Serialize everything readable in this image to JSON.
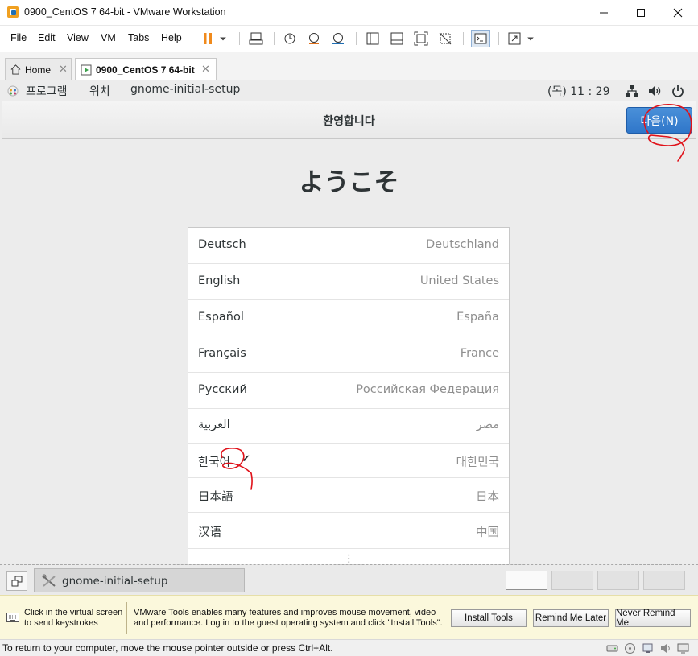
{
  "window": {
    "title": "0900_CentOS 7 64-bit - VMware Workstation",
    "controls": [
      "minimize",
      "maximize",
      "close"
    ]
  },
  "menubar": {
    "items": [
      "File",
      "Edit",
      "View",
      "VM",
      "Tabs",
      "Help"
    ]
  },
  "tabs": [
    {
      "label": "Home",
      "active": false
    },
    {
      "label": "0900_CentOS 7 64-bit",
      "active": true
    }
  ],
  "gnome_topbar": {
    "applications": "프로그램",
    "places": "위치",
    "app_name": "gnome-initial-setup",
    "clock": "(목) 11 : 29",
    "icons": [
      "network-icon",
      "volume-icon",
      "power-icon"
    ]
  },
  "setup": {
    "header_title": "환영합니다",
    "next_button": "다음(N)",
    "welcome": "ようこそ",
    "languages": [
      {
        "name": "Deutsch",
        "region": "Deutschland",
        "selected": false
      },
      {
        "name": "English",
        "region": "United States",
        "selected": false
      },
      {
        "name": "Español",
        "region": "España",
        "selected": false
      },
      {
        "name": "Français",
        "region": "France",
        "selected": false
      },
      {
        "name": "Русский",
        "region": "Российская Федерация",
        "selected": false
      },
      {
        "name": "العربية",
        "region": "مصر",
        "selected": false
      },
      {
        "name": "한국어",
        "region": "대한민국",
        "selected": true,
        "check": "✔"
      },
      {
        "name": "日本語",
        "region": "日本",
        "selected": false
      },
      {
        "name": "汉语",
        "region": "中国",
        "selected": false
      }
    ],
    "more_indicator": "⋮"
  },
  "taskbar": {
    "task_label": "gnome-initial-setup",
    "workspaces": 4,
    "active_workspace": 1
  },
  "tools_bar": {
    "hint": "Click in the virtual screen\nto send keystrokes",
    "message": "VMware Tools enables many features and improves mouse movement, video and performance. Log in to the guest operating system and click \"Install Tools\".",
    "install_button": "Install Tools",
    "remind_button": "Remind Me Later",
    "never_button": "Never Remind Me"
  },
  "statusbar": {
    "message": "To return to your computer, move the mouse pointer outside or press Ctrl+Alt."
  },
  "colors": {
    "accent_blue": "#3a82d0",
    "annotation_red": "#e0121a",
    "tools_bar_bg": "#fbf8dc"
  }
}
